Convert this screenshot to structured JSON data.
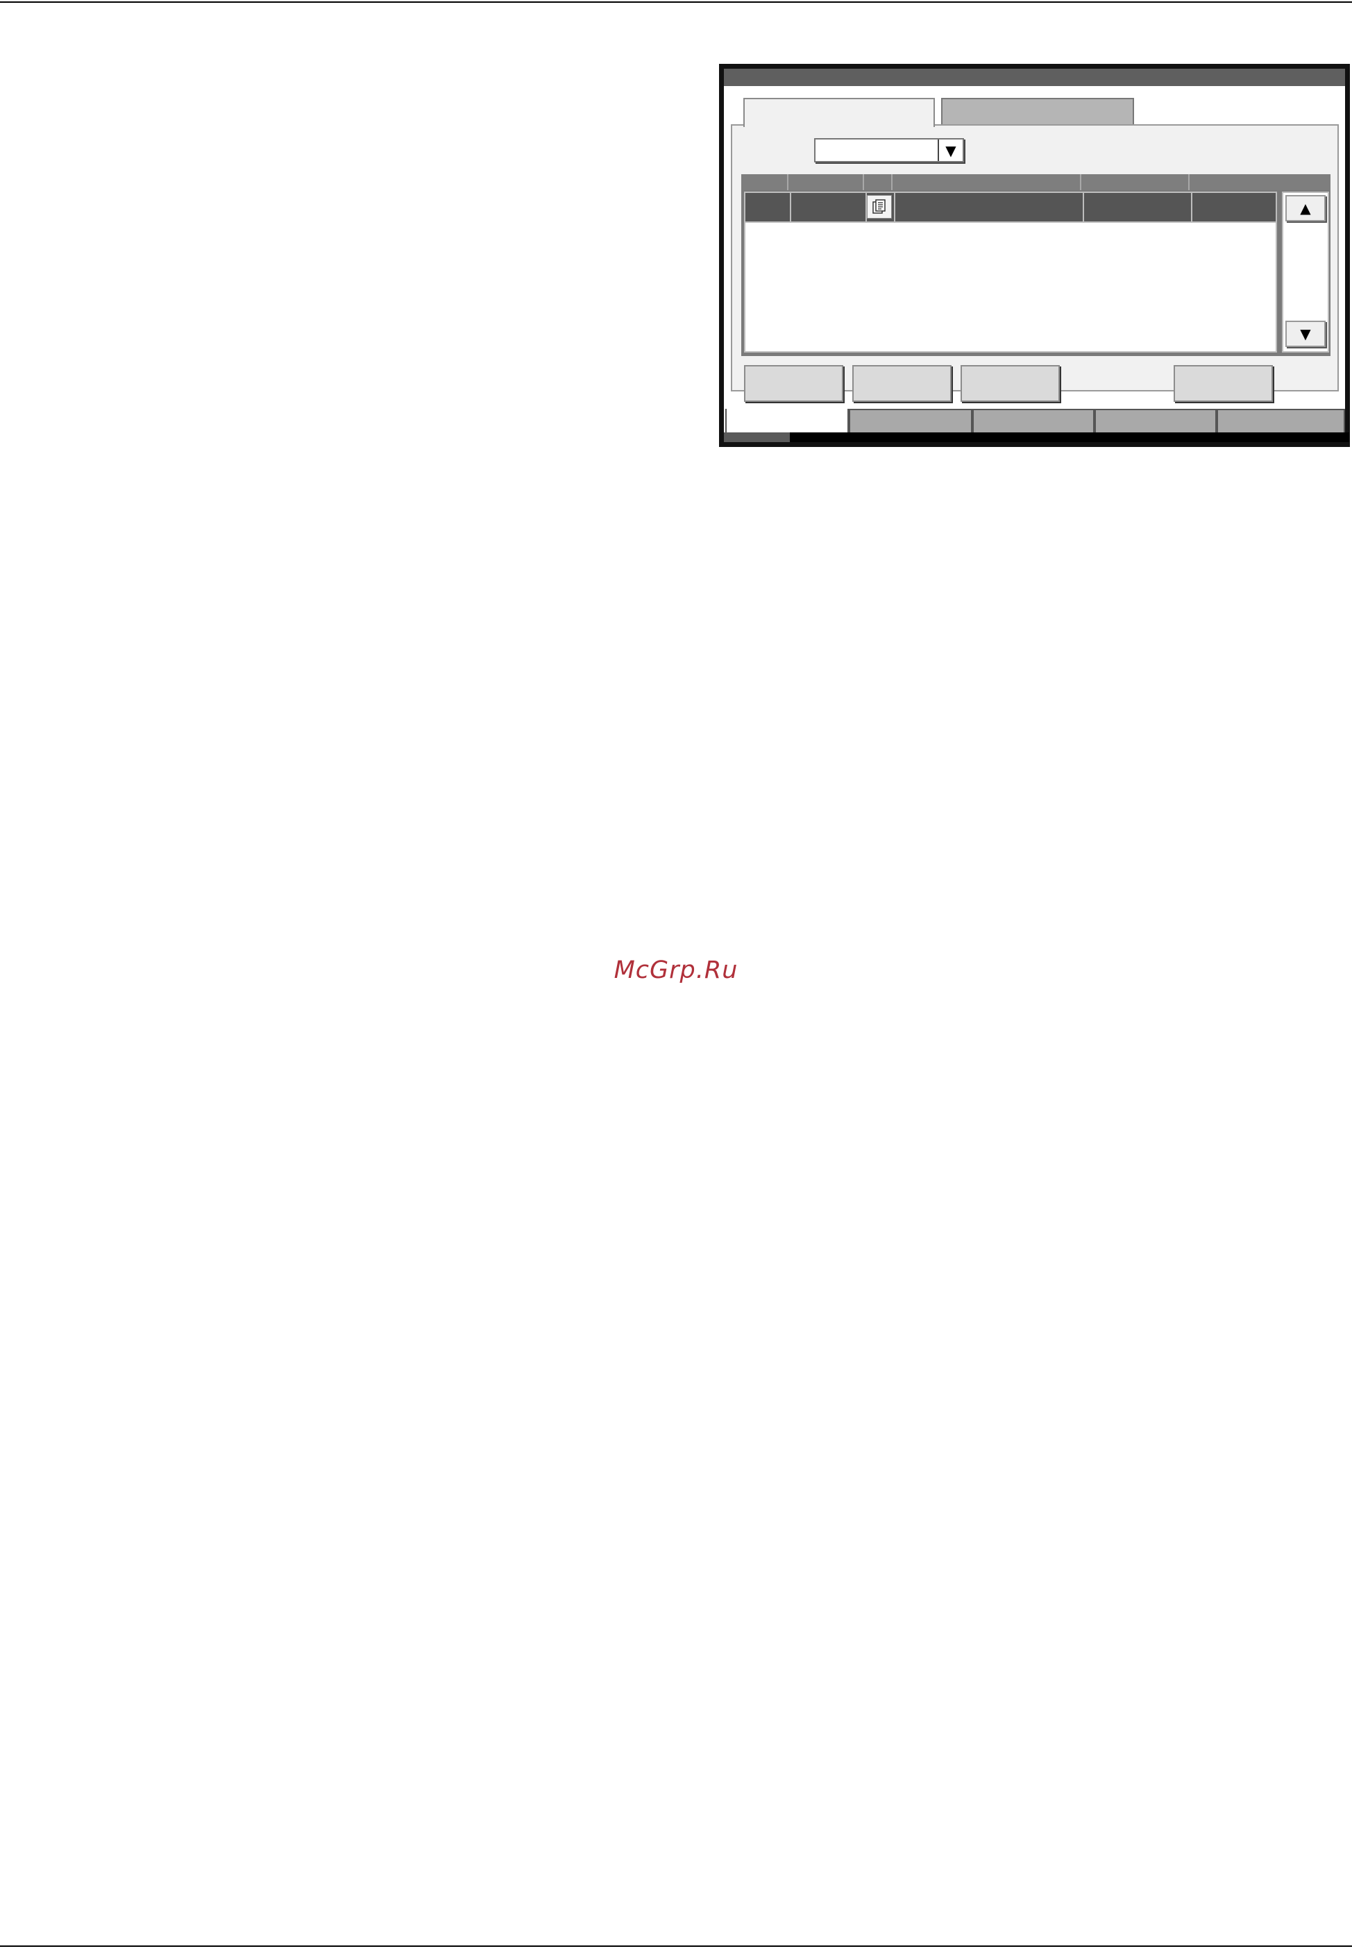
{
  "watermark": {
    "text": "McGrp.Ru",
    "color": "#b0303a"
  },
  "panel": {
    "title": "",
    "tabs": [
      {
        "label": "",
        "active": true
      },
      {
        "label": "",
        "active": false
      }
    ],
    "dropdown": {
      "value": "",
      "arrow_icon": "triangle-down"
    },
    "list": {
      "columns": [
        "",
        "",
        "",
        "",
        "",
        ""
      ],
      "rows": [
        {
          "cells": [
            "",
            "",
            "",
            "",
            "",
            ""
          ],
          "icon": "document-icon",
          "selected": true
        }
      ]
    },
    "scroll": {
      "up_icon": "triangle-up",
      "down_icon": "triangle-down"
    },
    "actions": [
      "",
      "",
      "",
      ""
    ],
    "bottom_tabs": [
      "",
      "",
      "",
      "",
      ""
    ]
  },
  "colors": {
    "title_bar": "#5f5f5f",
    "selected_row": "#555555",
    "button_face": "#dadada",
    "inactive_tab": "#a9a9a9"
  }
}
